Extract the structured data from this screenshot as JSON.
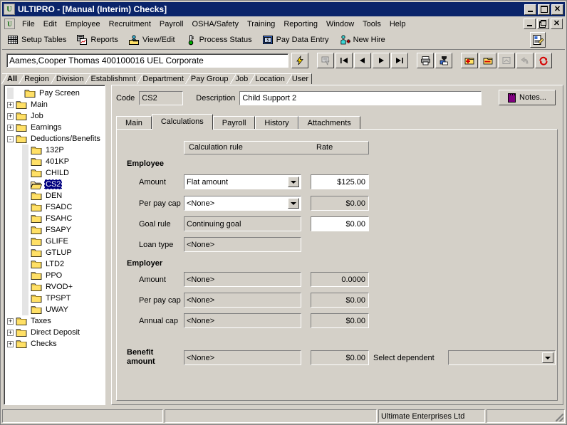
{
  "window": {
    "title": "ULTIPRO - [Manual (Interim) Checks]",
    "app_icon": "ultipro-logo-icon",
    "minimize": "minimize-icon",
    "maximize": "maximize-icon",
    "close": "close-icon"
  },
  "menubar": {
    "items": [
      {
        "label": "File"
      },
      {
        "label": "Edit"
      },
      {
        "label": "Employee"
      },
      {
        "label": "Recruitment"
      },
      {
        "label": "Payroll"
      },
      {
        "label": "OSHA/Safety"
      },
      {
        "label": "Training"
      },
      {
        "label": "Reporting"
      },
      {
        "label": "Window"
      },
      {
        "label": "Tools"
      },
      {
        "label": "Help"
      }
    ],
    "mdi_minimize": "minimize-icon",
    "mdi_restore": "restore-icon",
    "mdi_close": "close-icon"
  },
  "toolbar": {
    "items": [
      {
        "label": "Setup Tables",
        "icon": "grid-table-icon"
      },
      {
        "label": "Reports",
        "icon": "reports-stack-icon"
      },
      {
        "label": "View/Edit",
        "icon": "person-folder-icon"
      },
      {
        "label": "Process Status",
        "icon": "thermometer-icon"
      },
      {
        "label": "Pay Data Entry",
        "icon": "money-grid-icon"
      },
      {
        "label": "New Hire",
        "icon": "new-hire-person-plus-icon"
      }
    ],
    "right_buttons": [
      {
        "icon": "edit-form-icon"
      },
      {
        "icon": "blank-icon"
      }
    ]
  },
  "employee_bar": {
    "value": "Aames,Cooper Thomas 400100016  UEL Corporate",
    "lightning_icon": "lightning-bolt-icon",
    "nav": [
      {
        "icon": "filter-icon"
      },
      {
        "icon": "first-record-icon"
      },
      {
        "icon": "previous-record-icon"
      },
      {
        "icon": "next-record-icon"
      },
      {
        "icon": "last-record-icon"
      },
      {
        "icon": "print-icon"
      },
      {
        "icon": "print-preview-icon"
      },
      {
        "icon": "add-record-icon"
      },
      {
        "icon": "delete-record-icon"
      },
      {
        "icon": "copy-record-icon"
      },
      {
        "icon": "undo-icon"
      },
      {
        "icon": "refresh-icon"
      }
    ]
  },
  "filter_tabs": {
    "items": [
      {
        "label": "All",
        "active": true
      },
      {
        "label": "Region",
        "active": false
      },
      {
        "label": "Division",
        "active": false
      },
      {
        "label": "Establishmnt",
        "active": false
      },
      {
        "label": "Department",
        "active": false
      },
      {
        "label": "Pay Group",
        "active": false
      },
      {
        "label": "Job",
        "active": false
      },
      {
        "label": "Location",
        "active": false
      },
      {
        "label": "User",
        "active": false
      }
    ]
  },
  "tree": {
    "nodes": [
      {
        "label": "Pay Screen",
        "level": 1,
        "expander": "",
        "selected": false
      },
      {
        "label": "Main",
        "level": 1,
        "expander": "+",
        "selected": false
      },
      {
        "label": "Job",
        "level": 1,
        "expander": "+",
        "selected": false
      },
      {
        "label": "Earnings",
        "level": 1,
        "expander": "+",
        "selected": false
      },
      {
        "label": "Deductions/Benefits",
        "level": 1,
        "expander": "-",
        "selected": false
      },
      {
        "label": "132P",
        "level": 2,
        "expander": "",
        "selected": false
      },
      {
        "label": "401KP",
        "level": 2,
        "expander": "",
        "selected": false
      },
      {
        "label": "CHILD",
        "level": 2,
        "expander": "",
        "selected": false
      },
      {
        "label": "CS2",
        "level": 2,
        "expander": "",
        "selected": true
      },
      {
        "label": "DEN",
        "level": 2,
        "expander": "",
        "selected": false
      },
      {
        "label": "FSADC",
        "level": 2,
        "expander": "",
        "selected": false
      },
      {
        "label": "FSAHC",
        "level": 2,
        "expander": "",
        "selected": false
      },
      {
        "label": "FSAPY",
        "level": 2,
        "expander": "",
        "selected": false
      },
      {
        "label": "GLIFE",
        "level": 2,
        "expander": "",
        "selected": false
      },
      {
        "label": "GTLUP",
        "level": 2,
        "expander": "",
        "selected": false
      },
      {
        "label": "LTD2",
        "level": 2,
        "expander": "",
        "selected": false
      },
      {
        "label": "PPO",
        "level": 2,
        "expander": "",
        "selected": false
      },
      {
        "label": "RVOD+",
        "level": 2,
        "expander": "",
        "selected": false
      },
      {
        "label": "TPSPT",
        "level": 2,
        "expander": "",
        "selected": false
      },
      {
        "label": "UWAY",
        "level": 2,
        "expander": "",
        "selected": false
      },
      {
        "label": "Taxes",
        "level": 1,
        "expander": "+",
        "selected": false
      },
      {
        "label": "Direct Deposit",
        "level": 1,
        "expander": "+",
        "selected": false
      },
      {
        "label": "Checks",
        "level": 1,
        "expander": "+",
        "selected": false
      }
    ]
  },
  "form_header": {
    "code_label": "Code",
    "code_value": "CS2",
    "description_label": "Description",
    "description_value": "Child Support 2",
    "notes_label": "Notes...",
    "notes_icon": "notepad-icon"
  },
  "tabs": [
    {
      "label": "Main",
      "active": false
    },
    {
      "label": "Calculations",
      "active": true
    },
    {
      "label": "Payroll",
      "active": false
    },
    {
      "label": "History",
      "active": false
    },
    {
      "label": "Attachments",
      "active": false
    }
  ],
  "calculations": {
    "col_calculation_rule": "Calculation rule",
    "col_rate": "Rate",
    "employee_group": "Employee",
    "employer_group": "Employer",
    "benefit_group_line1": "Benefit",
    "benefit_group_line2": "amount",
    "select_dependent_label": "Select dependent",
    "select_dependent_value": "",
    "rows": [
      {
        "label": "Amount",
        "rule": "Flat amount",
        "rate": "$125.00",
        "rule_combo": true,
        "rule_editable": true,
        "rate_editable": true
      },
      {
        "label": "Per pay cap",
        "rule": "<None>",
        "rate": "$0.00",
        "rule_combo": true,
        "rule_editable": true,
        "rate_editable": false
      },
      {
        "label": "Goal rule",
        "rule": "Continuing goal",
        "rate": "$0.00",
        "rule_combo": false,
        "rule_editable": false,
        "rate_editable": true
      },
      {
        "label": "Loan type",
        "rule": "<None>",
        "rate": null,
        "rule_combo": false,
        "rule_editable": false,
        "rate_editable": false
      }
    ],
    "employer_rows": [
      {
        "label": "Amount",
        "rule": "<None>",
        "rate": "0.0000"
      },
      {
        "label": "Per pay cap",
        "rule": "<None>",
        "rate": "$0.00"
      },
      {
        "label": "Annual cap",
        "rule": "<None>",
        "rate": "$0.00"
      }
    ],
    "benefit_row": {
      "rule": "<None>",
      "rate": "$0.00"
    }
  },
  "statusbar": {
    "panel1": "",
    "panel2": "",
    "company": "Ultimate Enterprises Ltd",
    "panel4": ""
  }
}
